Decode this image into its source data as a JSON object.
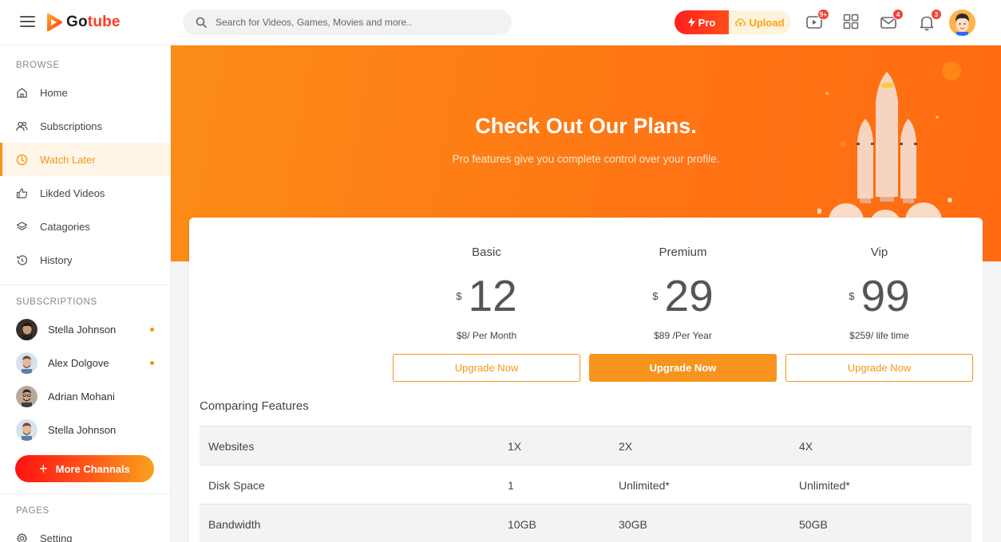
{
  "app": {
    "name_part1": "Go",
    "name_part2": "tube"
  },
  "search": {
    "placeholder": "Search for Videos, Games, Movies and more.."
  },
  "header": {
    "pro_label": "Pro",
    "upload_label": "Upload",
    "badges": {
      "videos": "9+",
      "messages": "4",
      "notifications": "3"
    }
  },
  "sidebar": {
    "browse_title": "BROWSE",
    "items": [
      {
        "label": "Home",
        "icon": "home-icon"
      },
      {
        "label": "Subscriptions",
        "icon": "users-icon"
      },
      {
        "label": "Watch Later",
        "icon": "clock-icon",
        "active": true
      },
      {
        "label": "Likded Videos",
        "icon": "thumbs-up-icon"
      },
      {
        "label": "Catagories",
        "icon": "layers-icon"
      },
      {
        "label": "History",
        "icon": "history-icon"
      }
    ],
    "subscriptions_title": "SUBSCRIPTIONS",
    "subscriptions": [
      {
        "name": "Stella Johnson",
        "online": true
      },
      {
        "name": "Alex Dolgove",
        "online": true
      },
      {
        "name": "Adrian Mohani",
        "online": false
      },
      {
        "name": "Stella Johnson",
        "online": false
      }
    ],
    "more_label": "More Channals",
    "pages_title": "PAGES",
    "pages": [
      {
        "label": "Setting",
        "icon": "gear-icon"
      }
    ]
  },
  "hero": {
    "title": "Check Out Our Plans.",
    "subtitle": "Pro features give you complete control over your profile."
  },
  "plans": [
    {
      "name": "Basic",
      "currency": "$",
      "price": "12",
      "period": "$8/ Per Month",
      "button": "Upgrade Now",
      "featured": false
    },
    {
      "name": "Premium",
      "currency": "$",
      "price": "29",
      "period": "$89 /Per Year",
      "button": "Upgrade Now",
      "featured": true
    },
    {
      "name": "Vip",
      "currency": "$",
      "price": "99",
      "period": "$259/ life time",
      "button": "Upgrade Now",
      "featured": false
    }
  ],
  "compare": {
    "title": "Comparing Features",
    "rows": [
      {
        "feature": "Websites",
        "basic": "1X",
        "premium": "2X",
        "vip": "4X"
      },
      {
        "feature": "Disk Space",
        "basic": "1",
        "premium": "Unlimited*",
        "vip": "Unlimited*"
      },
      {
        "feature": "Bandwidth",
        "basic": "10GB",
        "premium": "30GB",
        "vip": "50GB"
      }
    ]
  },
  "colors": {
    "accent": "#f7941d",
    "brand_red": "#ff3c1f",
    "badge": "#f44336"
  }
}
